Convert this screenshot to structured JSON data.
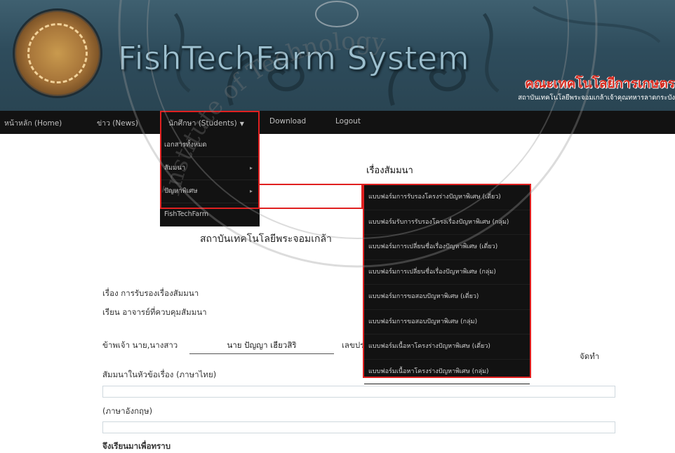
{
  "header": {
    "system_title": "FishTechFarm System",
    "faculty_th": "คณะเทคโนโลยีการเกษตร",
    "institute_th": "สถาบันเทคโนโลยีพระจอมเกล้าเจ้าคุณทหารลาดกระบัง"
  },
  "navbar": {
    "items": [
      {
        "label": "หน้าหลัก (Home)"
      },
      {
        "label": "ข่าว (News)"
      },
      {
        "label": "นักศึกษา (Students)"
      },
      {
        "label": "Download"
      },
      {
        "label": "Logout"
      }
    ]
  },
  "students_menu": {
    "items": [
      {
        "label": "เอกสารทั้งหมด"
      },
      {
        "label": "สัมมนา"
      },
      {
        "label": "ปัญหาพิเศษ"
      },
      {
        "label": "FishTechFarm"
      }
    ]
  },
  "special_problem_menu": {
    "items": [
      {
        "label": "แบบฟอร์มการรับรองโครงร่างปัญหาพิเศษ (เดี่ยว)"
      },
      {
        "label": "แบบฟอร์มรับการรับรองโครงเรื่องปัญหาพิเศษ (กลุ่ม)"
      },
      {
        "label": "แบบฟอร์มการเปลี่ยนชื่อเรื่องปัญหาพิเศษ (เดี่ยว)"
      },
      {
        "label": "แบบฟอร์มการเปลี่ยนชื่อเรื่องปัญหาพิเศษ (กลุ่ม)"
      },
      {
        "label": "แบบฟอร์มการขอสอบปัญหาพิเศษ (เดี่ยว)"
      },
      {
        "label": "แบบฟอร์มการขอสอบปัญหาพิเศษ (กลุ่ม)"
      },
      {
        "label": "แบบฟอร์มเนื้อหาโครงร่างปัญหาพิเศษ (เดี่ยว)"
      },
      {
        "label": "แบบฟอร์มเนื้อหาโครงร่างปัญหาพิเศษ (กลุ่ม)"
      }
    ]
  },
  "form": {
    "page_title": "เรื่องสัมมนา",
    "institute_heading": "สถาบันเทคโนโลยีพระจอมเกล้า",
    "subject_line": "เรื่อง การรับรองเรื่องสัมมนา",
    "to_line": "เรียน อาจารย์ที่ควบคุมสัมมนา",
    "i_prefix": "ข้าพเจ้า นาย,นางสาว",
    "student_name": "นาย ปัญญา เฮียวสิริ",
    "id_prefix": "เลขปร",
    "make_label": "จัดทำ",
    "thai_title_label": "สัมมนาในหัวข้อเรื่อง (ภาษาไทย)",
    "thai_title_value": "",
    "english_label": "(ภาษาอังกฤษ)",
    "english_title_value": "",
    "closing": "จึงเรียนมาเพื่อทราบ"
  },
  "watermark": {
    "text": "Institute of Technology"
  },
  "colors": {
    "nav_bg": "#121212",
    "highlight": "#e02020",
    "faculty_text": "#d62a1e"
  }
}
